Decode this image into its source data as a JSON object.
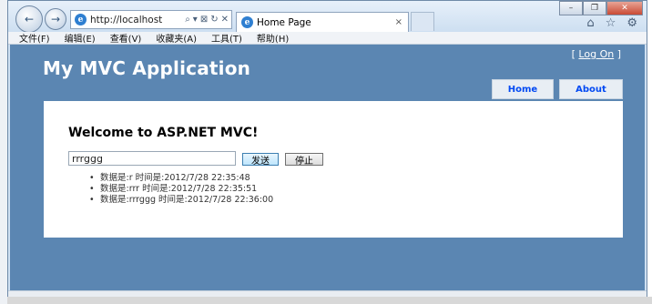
{
  "browser": {
    "address_url": "http://localhost",
    "address_tools": [
      "⌕",
      "▾",
      "⊠",
      "↻",
      "✕"
    ],
    "tab_title": "Home Page",
    "tab_close": "×",
    "window_buttons": [
      "–",
      "❐",
      "✕"
    ],
    "tool_icons": [
      "⌂",
      "☆",
      "⚙"
    ],
    "menu": [
      "文件(F)",
      "编辑(E)",
      "查看(V)",
      "收藏夹(A)",
      "工具(T)",
      "帮助(H)"
    ]
  },
  "site": {
    "title": "My MVC Application",
    "logon_left": "[ ",
    "logon_link": "Log On",
    "logon_right": " ]",
    "nav": [
      "Home",
      "About"
    ]
  },
  "content": {
    "heading": "Welcome to ASP.NET MVC!",
    "input_value": "rrrggg",
    "send_label": "发送",
    "stop_label": "停止",
    "messages": [
      "数据是:r 时间是:2012/7/28 22:35:48",
      "数据是:rrr 时间是:2012/7/28 22:35:51",
      "数据是:rrrggg 时间是:2012/7/28 22:36:00"
    ]
  }
}
